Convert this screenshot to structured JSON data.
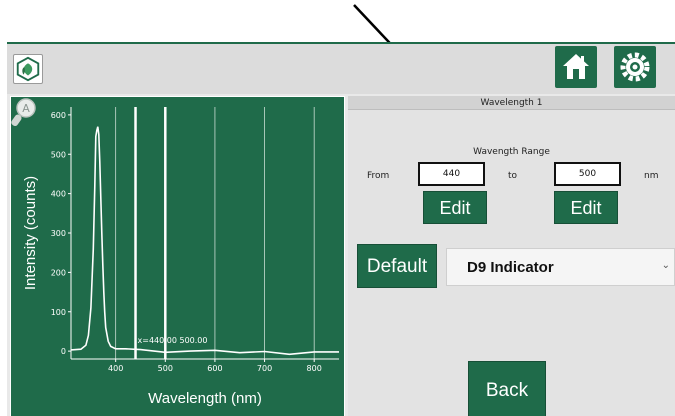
{
  "header": {
    "logo_icon": "plant-leaf-logo-icon",
    "home_icon": "home-icon",
    "settings_icon": "gear-icon"
  },
  "wavelength_panel": {
    "title": "Wavelength 1",
    "range_title": "Wavength Range",
    "from_label": "From",
    "from_value": "440",
    "to_label": "to",
    "to_value": "500",
    "unit_label": "nm",
    "edit_from_label": "Edit",
    "edit_to_label": "Edit",
    "default_label": "Default",
    "indicator_selected": "D9 Indicator",
    "back_label": "Back"
  },
  "chart_data": {
    "type": "line",
    "xlabel": "Wavelength (nm)",
    "ylabel": "Intensity (counts)",
    "xlim": [
      310,
      850
    ],
    "ylim": [
      -20,
      620
    ],
    "xticks": [
      400,
      500,
      600,
      700,
      800
    ],
    "yticks": [
      0,
      100,
      200,
      300,
      400,
      500,
      600
    ],
    "x_grid": true,
    "y_grid": false,
    "cursor_readout": "x=440.00 500.00",
    "markers": [
      440,
      500
    ],
    "series": [
      {
        "x": [
          310,
          330,
          340,
          345,
          350,
          355,
          358,
          360,
          362,
          364,
          366,
          368,
          370,
          372,
          374,
          376,
          378,
          380,
          385,
          390,
          400,
          420,
          450,
          500,
          550,
          600,
          650,
          700,
          750,
          800,
          850
        ],
        "values": [
          3,
          5,
          15,
          40,
          110,
          260,
          420,
          545,
          560,
          570,
          550,
          480,
          390,
          300,
          220,
          150,
          100,
          60,
          25,
          12,
          6,
          6,
          4,
          -3,
          0,
          2,
          -4,
          -1,
          -8,
          -2,
          -2
        ]
      }
    ]
  },
  "zoom_icon": "magnifier-icon",
  "annotation": {
    "arrow_icon": "pointer-arrow-icon"
  }
}
